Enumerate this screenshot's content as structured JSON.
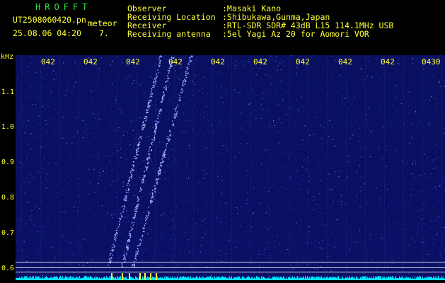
{
  "header": {
    "title_letters": "HROFFT",
    "filename": "UT2508060420.pn",
    "mode": "meteor",
    "datetime": "25.08.06 04:20",
    "count": "7.",
    "info": [
      {
        "label": "Observer",
        "value": ":Masaki Kano"
      },
      {
        "label": "Receiving Location",
        "value": ":Shibukawa,Gunma,Japan"
      },
      {
        "label": "Receiver",
        "value": ":RTL-SDR SDR# 43dB L15 114.1MHz USB"
      },
      {
        "label": "Receiving antenna",
        "value": ":5el Yagi Az 20 for Aomori VOR"
      }
    ]
  },
  "axes": {
    "y_unit": "kHz",
    "y_ticks": [
      "1.1",
      "1.0",
      "0.9",
      "0.8",
      "0.7",
      "0.6"
    ],
    "x_ticks": [
      "042",
      "042",
      "042",
      "042",
      "042",
      "042",
      "042",
      "042",
      "042",
      "0430"
    ]
  },
  "colors": {
    "background": "#0a0f63",
    "text_yellow": "#ffff33",
    "title_green": "#33e04a",
    "meteor_trace": "#9fb6ff",
    "baseline": "#00ffff"
  }
}
